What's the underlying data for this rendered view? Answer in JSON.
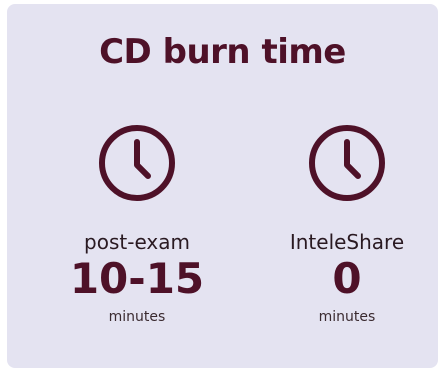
{
  "card": {
    "title": "CD burn time",
    "accent_color": "#4e1128",
    "background_color": "#e4e3f1"
  },
  "stats": [
    {
      "icon": "clock-icon",
      "label": "post-exam",
      "value": "10-15",
      "unit": "minutes"
    },
    {
      "icon": "clock-icon",
      "label": "InteleShare",
      "value": "0",
      "unit": "minutes"
    }
  ]
}
